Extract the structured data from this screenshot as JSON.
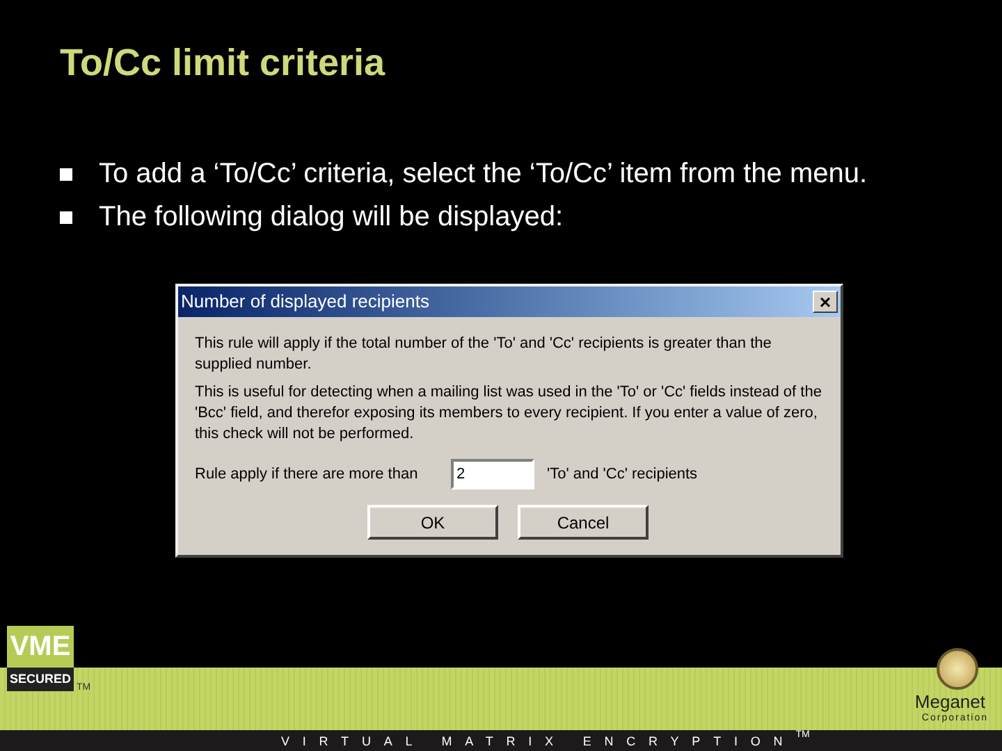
{
  "slide": {
    "title": "To/Cc limit criteria"
  },
  "bullets": [
    "To add a ‘To/Cc’ criteria, select the ‘To/Cc’ item from the menu.",
    "The following dialog will be displayed:"
  ],
  "dialog": {
    "title": "Number of displayed recipients",
    "close": "×",
    "paragraphs": [
      "This rule will apply if the total number of the 'To' and 'Cc' recipients is greater than the supplied number.",
      "This is useful for detecting when a mailing list was used in the 'To' or 'Cc' fields instead of the 'Bcc' field, and therefor exposing its members to every recipient. If you enter a value of zero, this check will not be performed."
    ],
    "rule_label": "Rule apply if there are more than",
    "value": "2",
    "rule_suffix": "'To' and 'Cc' recipients",
    "buttons": [
      "OK",
      "Cancel"
    ]
  },
  "footer": {
    "badge_top": "VME",
    "badge_bottom": "SECURED",
    "badge_tm": "TM",
    "company": "Meganet",
    "company_sub": "Corporation",
    "tagline": "VIRTUAL MATRIX ENCRYPTION",
    "tagline_tm": "TM"
  }
}
